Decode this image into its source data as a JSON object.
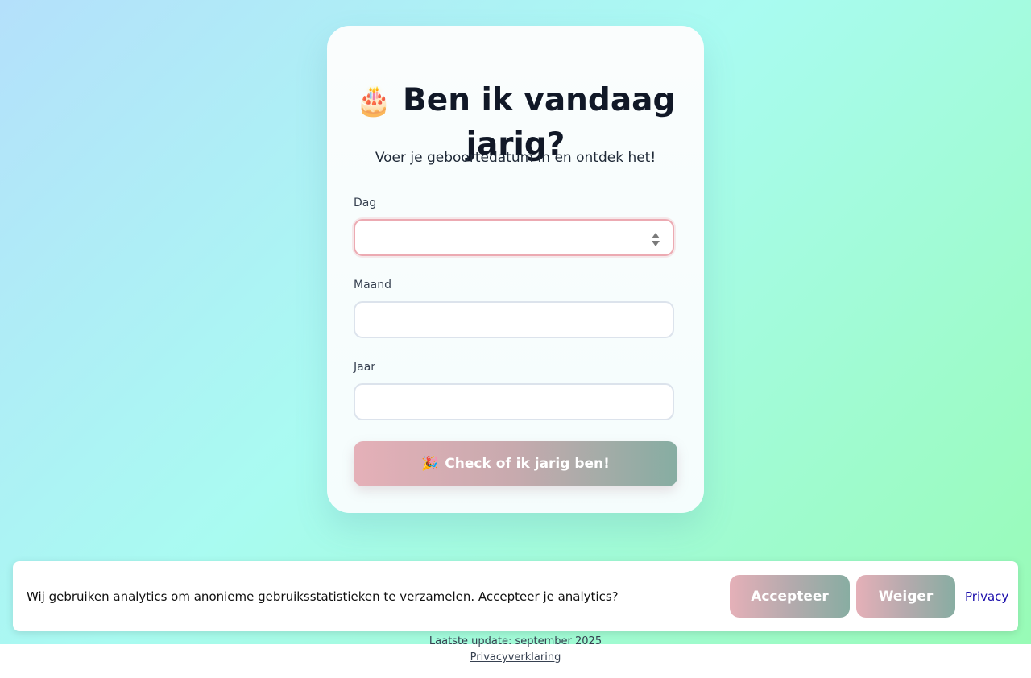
{
  "app": {
    "title_icon": "🎂",
    "title": "Ben ik vandaag jarig?",
    "subtitle": "Voer je geboortedatum in en ontdek het!"
  },
  "form": {
    "day_label": "Dag",
    "day_value": "",
    "month_label": "Maand",
    "month_value": "",
    "year_label": "Jaar",
    "year_value": "",
    "submit_icon": "🎉",
    "submit_label": "Check of ik jarig ben!"
  },
  "footer": {
    "last_update": "Laatste update: september 2025",
    "privacy_link": "Privacyverklaring"
  },
  "cookie_banner": {
    "text": "Wij gebruiken analytics om anonieme gebruiksstatistieken te verzamelen. Accepteer je analytics?",
    "accept_label": "Accepteer",
    "decline_label": "Weiger",
    "privacy_label": "Privacy"
  },
  "colors": {
    "accent_start": "#e5b0b8",
    "accent_end": "#86ada2",
    "active_border": "#ecaab2"
  }
}
